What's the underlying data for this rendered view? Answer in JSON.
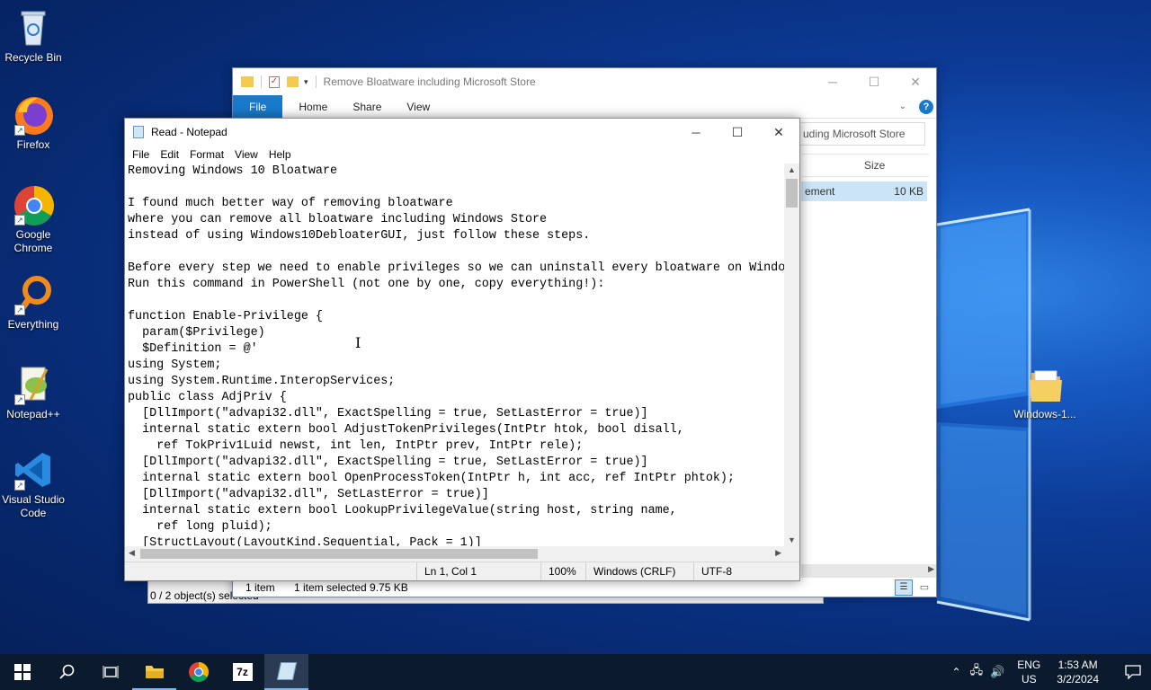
{
  "desktop": {
    "icons": [
      {
        "label": "Recycle Bin"
      },
      {
        "label": "Firefox"
      },
      {
        "label": "Google Chrome"
      },
      {
        "label": "Everything"
      },
      {
        "label": "Notepad++"
      },
      {
        "label": "Visual Studio Code"
      },
      {
        "label": "Windows-1..."
      }
    ]
  },
  "explorer": {
    "title": "Remove Bloatware including Microsoft Store",
    "tabs": [
      "File",
      "Home",
      "Share",
      "View"
    ],
    "search_text": "uding Microsoft Store",
    "column_size": "Size",
    "row_name": "ement",
    "row_size": "10 KB",
    "status_items": "1 item",
    "status_selected": "1 item selected  9.75 KB",
    "behind_status": "0 / 2 object(s) selected"
  },
  "notepad": {
    "title": "Read - Notepad",
    "menu": [
      "File",
      "Edit",
      "Format",
      "View",
      "Help"
    ],
    "content": "Removing Windows 10 Bloatware\n\nI found much better way of removing bloatware\nwhere you can remove all bloatware including Windows Store\ninstead of using Windows10DebloaterGUI, just follow these steps.\n\nBefore every step we need to enable privileges so we can uninstall every bloatware on Windo\nRun this command in PowerShell (not one by one, copy everything!):\n\nfunction Enable-Privilege {\n  param($Privilege)\n  $Definition = @'\nusing System;\nusing System.Runtime.InteropServices;\npublic class AdjPriv {\n  [DllImport(\"advapi32.dll\", ExactSpelling = true, SetLastError = true)]\n  internal static extern bool AdjustTokenPrivileges(IntPtr htok, bool disall,\n    ref TokPriv1Luid newst, int len, IntPtr prev, IntPtr rele);\n  [DllImport(\"advapi32.dll\", ExactSpelling = true, SetLastError = true)]\n  internal static extern bool OpenProcessToken(IntPtr h, int acc, ref IntPtr phtok);\n  [DllImport(\"advapi32.dll\", SetLastError = true)]\n  internal static extern bool LookupPrivilegeValue(string host, string name,\n    ref long pluid);\n  [StructLayout(LayoutKind.Sequential, Pack = 1)]",
    "status": {
      "position": "Ln 1, Col 1",
      "zoom": "100%",
      "line_ending": "Windows (CRLF)",
      "encoding": "UTF-8"
    }
  },
  "taskbar": {
    "lang_top": "ENG",
    "lang_bottom": "US",
    "time": "1:53 AM",
    "date": "3/2/2024"
  }
}
